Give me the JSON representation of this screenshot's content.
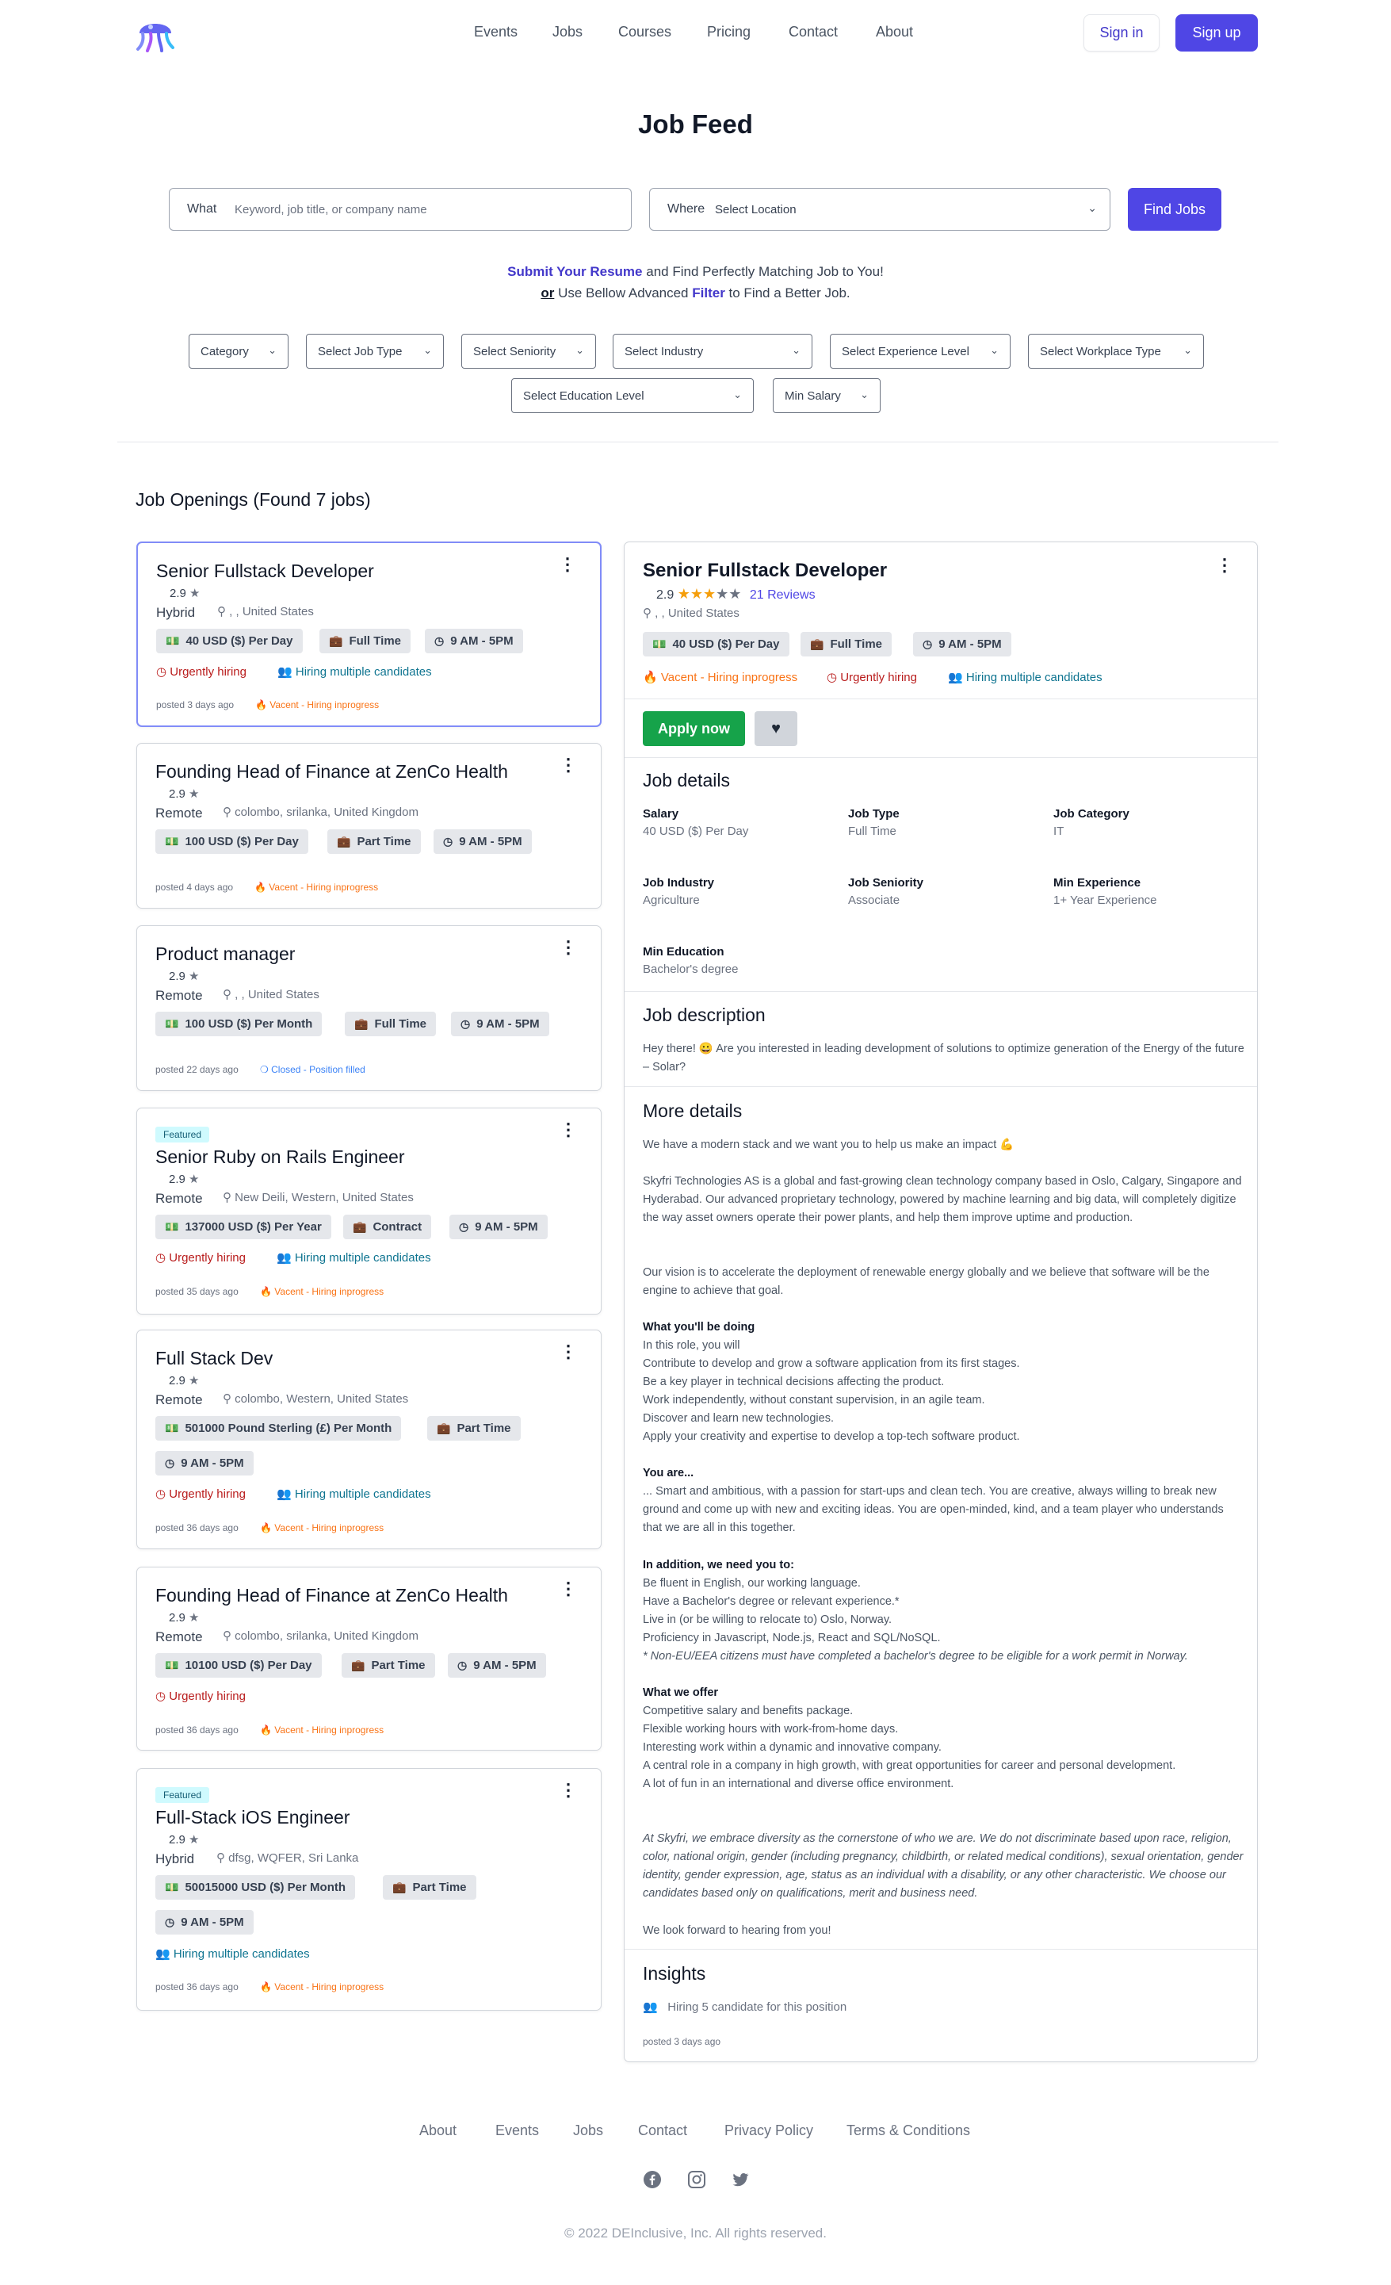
{
  "header": {
    "nav": [
      "Events",
      "Jobs",
      "Courses",
      "Pricing",
      "Contact",
      "About"
    ],
    "signin": "Sign in",
    "signup": "Sign up"
  },
  "page_title": "Job Feed",
  "search": {
    "what_label": "What",
    "what_placeholder": "Keyword, job title, or company name",
    "where_label": "Where",
    "where_value": "Select Location",
    "find_label": "Find Jobs"
  },
  "tagline": {
    "link1": "Submit Your Resume",
    "rest1": " and Find Perfectly Matching Job to You!",
    "or": "or",
    "rest2a": " Use Bellow Advanced ",
    "link2": "Filter",
    "rest2b": " to Find a Better Job."
  },
  "filters": [
    "Category",
    "Select Job Type",
    "Select Seniority",
    "Select Industry",
    "Select Experience Level",
    "Select Workplace Type",
    "Select Education Level",
    "Min Salary"
  ],
  "openings_title": "Job Openings (Found 7 jobs)",
  "jobs": [
    {
      "title": "Senior Fullstack Developer",
      "rating": "2.9",
      "work": "Hybrid",
      "location": ", , United States",
      "salary": "40 USD ($) Per Day",
      "type": "Full Time",
      "hours": "9 AM - 5PM",
      "urgent": "Urgently hiring",
      "multi": "Hiring multiple candidates",
      "posted": "posted 3 days ago",
      "status": "Vacent - Hiring inprogress"
    },
    {
      "title": "Founding Head of Finance at ZenCo Health",
      "rating": "2.9",
      "work": "Remote",
      "location": "colombo, srilanka, United Kingdom",
      "salary": "100 USD ($) Per Day",
      "type": "Part Time",
      "hours": "9 AM - 5PM",
      "posted": "posted 4 days ago",
      "status": "Vacent - Hiring inprogress"
    },
    {
      "title": "Product manager",
      "rating": "2.9",
      "work": "Remote",
      "location": ", , United States",
      "salary": "100 USD ($) Per Month",
      "type": "Full Time",
      "hours": "9 AM - 5PM",
      "posted": "posted 22 days ago",
      "status": "Closed - Position filled"
    },
    {
      "badge": "Featured",
      "title": "Senior Ruby on Rails Engineer",
      "rating": "2.9",
      "work": "Remote",
      "location": "New Deili, Western, United States",
      "salary": "137000 USD ($) Per Year",
      "type": "Contract",
      "hours": "9 AM - 5PM",
      "urgent": "Urgently hiring",
      "multi": "Hiring multiple candidates",
      "posted": "posted 35 days ago",
      "status": "Vacent - Hiring inprogress"
    },
    {
      "title": "Full Stack Dev",
      "rating": "2.9",
      "work": "Remote",
      "location": "colombo, Western, United States",
      "salary": "501000 Pound Sterling (£) Per Month",
      "type": "Part Time",
      "hours": "9 AM - 5PM",
      "urgent": "Urgently hiring",
      "multi": "Hiring multiple candidates",
      "posted": "posted 36 days ago",
      "status": "Vacent - Hiring inprogress"
    },
    {
      "title": "Founding Head of Finance at ZenCo Health",
      "rating": "2.9",
      "work": "Remote",
      "location": "colombo, srilanka, United Kingdom",
      "salary": "10100 USD ($) Per Day",
      "type": "Part Time",
      "hours": "9 AM - 5PM",
      "urgent": "Urgently hiring",
      "posted": "posted 36 days ago",
      "status": "Vacent - Hiring inprogress"
    },
    {
      "badge": "Featured",
      "title": "Full-Stack iOS Engineer",
      "rating": "2.9",
      "work": "Hybrid",
      "location": "dfsg, WQFER, Sri Lanka",
      "salary": "50015000 USD ($) Per Month",
      "type": "Part Time",
      "hours": "9 AM - 5PM",
      "multi": "Hiring multiple candidates",
      "posted": "posted 36 days ago",
      "status": "Vacent - Hiring inprogress"
    }
  ],
  "detail": {
    "title": "Senior Fullstack Developer",
    "rating": "2.9",
    "rating_stars": 3,
    "reviews": "21 Reviews",
    "location": ", , United States",
    "salary": "40 USD ($) Per Day",
    "type": "Full Time",
    "hours": "9 AM - 5PM",
    "status": "Vacent - Hiring inprogress",
    "urgent": "Urgently hiring",
    "multi": "Hiring multiple candidates",
    "apply": "Apply now",
    "details_heading": "Job details",
    "fields": [
      {
        "label": "Salary",
        "value": "40 USD ($) Per Day"
      },
      {
        "label": "Job Type",
        "value": "Full Time"
      },
      {
        "label": "Job Category",
        "value": "IT"
      },
      {
        "label": "Job Industry",
        "value": "Agriculture"
      },
      {
        "label": "Job Seniority",
        "value": "Associate"
      },
      {
        "label": "Min Experience",
        "value": "1+ Year Experience"
      },
      {
        "label": "Min Education",
        "value": "Bachelor's degree"
      }
    ],
    "desc_heading": "Job description",
    "desc_a": "Hey there! ",
    "desc_b": " Are you interested in leading development of solutions to optimize generation of the Energy of the future – Solar?",
    "more_heading": "More details",
    "more_p1": "We have a modern stack and we want you to help us make an impact 💪",
    "more_p2": "Skyfri Technologies AS is a global and fast-growing clean technology company based in Oslo, Calgary, Singapore and Hyderabad. Our advanced proprietary technology, powered by machine learning and big data, will completely digitize the way asset owners operate their power plants, and help them improve uptime and production.",
    "more_p3": "Our vision is to accelerate the deployment of renewable energy globally and we believe that software will be the engine to achieve that goal.",
    "doing_h": "What you'll be doing",
    "doing": [
      "In this role, you will",
      "Contribute to develop and grow a software application from its first stages.",
      "Be a key player in technical decisions affecting the product.",
      "Work independently, without constant supervision, in an agile team.",
      "Discover and learn new technologies.",
      "Apply your creativity and expertise to develop a top-tech software product."
    ],
    "youare_h": "You are...",
    "youare": "... Smart and ambitious, with a passion for start-ups and clean tech. You are creative, always willing to break new ground and come up with new and exciting ideas. You are open-minded, kind, and a team player who understands that we are all in this together.",
    "addition_h": "In addition, we need you to:",
    "addition": [
      "Be fluent in English, our working language.",
      "Have a Bachelor's degree or relevant experience.*",
      "Live in (or be willing to relocate to) Oslo, Norway.",
      "Proficiency in Javascript, Node.js, React and SQL/NoSQL."
    ],
    "addition_note": "* Non-EU/EEA citizens must have completed a bachelor's degree to be eligible for a work permit in Norway.",
    "offer_h": "What we offer",
    "offer": [
      "Competitive salary and benefits package.",
      "Flexible working hours with work-from-home days.",
      "Interesting work within a dynamic and innovative company.",
      "A central role in a company in high growth, with great opportunities for career and personal development.",
      "A lot of fun in an international and diverse office environment."
    ],
    "diversity": "At Skyfri, we embrace diversity as the cornerstone of who we are. We do not discriminate based upon race, religion, color, national origin, gender (including pregnancy, childbirth, or related medical conditions), sexual orientation, gender identity, gender expression, age, status as an individual with a disability, or any other characteristic. We choose our candidates based only on qualifications, merit and business need.",
    "closing": "We look forward to hearing from you!",
    "insights_heading": "Insights",
    "insight": "Hiring 5 candidate for this position",
    "posted": "posted 3 days ago"
  },
  "footer": {
    "links": [
      "About",
      "Events",
      "Jobs",
      "Contact",
      "Privacy Policy",
      "Terms & Conditions"
    ],
    "copyright": "© 2022 DEInclusive, Inc. All rights reserved."
  },
  "colors": {
    "primary": "#4f46e5",
    "apply": "#16a34a",
    "urgent": "#b91c1c",
    "status": "#f97316",
    "star": "#f59e0b"
  }
}
